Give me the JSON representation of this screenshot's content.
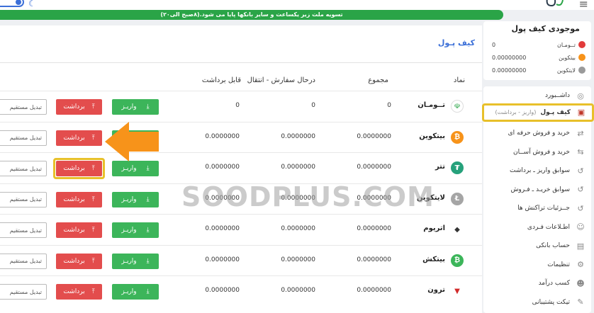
{
  "notice": "تسویه ملت زیر یکساعت و سایر بانکها پایا می شود.(۸صبح الی۲۰)",
  "sidebar": {
    "wallet_title": "موجودی کیف پول",
    "balances": [
      {
        "name": "تــومـان",
        "value": "0",
        "color": "#e23b3b"
      },
      {
        "name": "بیتکوین",
        "value": "0.00000000",
        "color": "#f7931a"
      },
      {
        "name": "لایتکوین",
        "value": "0.00000000",
        "color": "#9a9a9a"
      }
    ],
    "menu": [
      {
        "label": "داشــبورد",
        "icon": "◎",
        "sub": ""
      },
      {
        "label": "کیف پـول",
        "icon": "▣",
        "sub": "(واریز - برداشت)"
      },
      {
        "label": "خرید و فروش حرفه ای",
        "icon": "⇄",
        "sub": ""
      },
      {
        "label": "خرید و فروش آســان",
        "icon": "⇆",
        "sub": ""
      },
      {
        "label": "سوابق واریز ـ برداشت",
        "icon": "↺",
        "sub": ""
      },
      {
        "label": "سوابق خریـد ـ فـروش",
        "icon": "↺",
        "sub": ""
      },
      {
        "label": "جــزئیات تراکنش ها",
        "icon": "↺",
        "sub": ""
      },
      {
        "label": "اطـلاعات فـردی",
        "icon": "☺",
        "sub": ""
      },
      {
        "label": "حساب بانکی",
        "icon": "▤",
        "sub": ""
      },
      {
        "label": "تنظیمات",
        "icon": "⚙",
        "sub": ""
      },
      {
        "label": "کسب درآمد",
        "icon": "☻",
        "sub": ""
      },
      {
        "label": "تیکت پشتیبانی",
        "icon": "✎",
        "sub": ""
      }
    ]
  },
  "main": {
    "title": "کیف پـول",
    "headers": {
      "coin": "نماد",
      "total": "مجموع",
      "in_order": "درحال سفارش - انتقال",
      "available": "قابل برداشت"
    },
    "deposit_label": "واریـز",
    "withdraw_label": "برداشت",
    "convert_label": "تبدیل مستقیم",
    "rows": [
      {
        "name": "تــومـان",
        "total": "0",
        "in_order": "0",
        "available": "0",
        "color": "#ffffff",
        "symbol": "☫"
      },
      {
        "name": "بیتکوین",
        "total": "0.0000000",
        "in_order": "0.0000000",
        "available": "0.0000000",
        "color": "#f7931a",
        "symbol": "₿"
      },
      {
        "name": "تتر",
        "total": "0.0000000",
        "in_order": "0.0000000",
        "available": "0.0000000",
        "color": "#26a17b",
        "symbol": "₮"
      },
      {
        "name": "لایتکوین",
        "total": "0.0000000",
        "in_order": "0.0000000",
        "available": "0.0000000",
        "color": "#a5a5a5",
        "symbol": "Ł"
      },
      {
        "name": "اتریوم",
        "total": "0.0000000",
        "in_order": "0.0000000",
        "available": "0.0000000",
        "color": "#ffffff",
        "symbol": "◆"
      },
      {
        "name": "بیتکش",
        "total": "0.0000000",
        "in_order": "0.0000000",
        "available": "0.0000000",
        "color": "#3cb55a",
        "symbol": "₿"
      },
      {
        "name": "ترون",
        "total": "0.0000000",
        "in_order": "0.0000000",
        "available": "0.0000000",
        "color": "#ffffff",
        "symbol": "▼"
      }
    ]
  },
  "watermark": "SOODPLUS.COM"
}
